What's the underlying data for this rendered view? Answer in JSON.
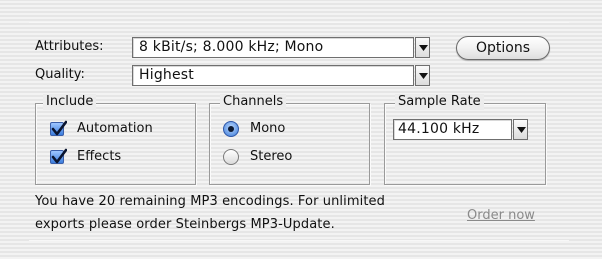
{
  "attributes": {
    "label": "Attributes:",
    "value": "8 kBit/s; 8.000 kHz; Mono"
  },
  "options_button": "Options",
  "quality": {
    "label": "Quality:",
    "value": "Highest"
  },
  "include": {
    "title": "Include",
    "items": [
      {
        "label": "Automation",
        "checked": true
      },
      {
        "label": "Effects",
        "checked": true
      }
    ]
  },
  "channels": {
    "title": "Channels",
    "options": [
      {
        "label": "Mono",
        "selected": true
      },
      {
        "label": "Stereo",
        "selected": false
      }
    ]
  },
  "sample_rate": {
    "title": "Sample Rate",
    "value": "44.100 kHz"
  },
  "message": {
    "line1": "You have 20 remaining MP3 encodings. For unlimited",
    "line2": "exports please order Steinbergs MP3-Update."
  },
  "order_link": "Order now",
  "colors": {
    "accent": "#3b7ddd",
    "link": "#8a8a8a"
  }
}
